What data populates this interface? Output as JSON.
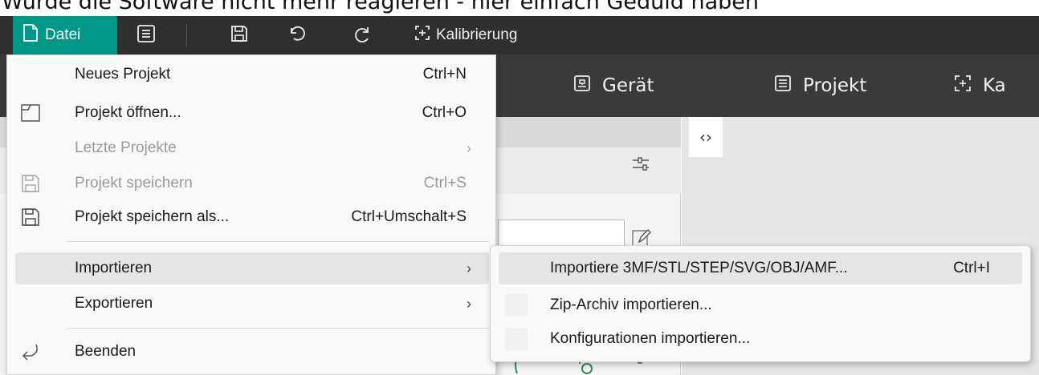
{
  "caption": "Wurde die Software nicht mehr reagieren - hier einfach Geduld haben",
  "toolbar": {
    "file_label": "Datei",
    "calibration_label": "Kalibrierung"
  },
  "tabs": [
    {
      "label": "Gerät"
    },
    {
      "label": "Projekt"
    },
    {
      "label": "Ka"
    }
  ],
  "file_menu": {
    "items": [
      {
        "label": "Neues Projekt",
        "shortcut": "Ctrl+N"
      },
      {
        "label": "Projekt öffnen...",
        "shortcut": "Ctrl+O"
      },
      {
        "label": "Letzte Projekte",
        "shortcut": ""
      },
      {
        "label": "Projekt speichern",
        "shortcut": "Ctrl+S"
      },
      {
        "label": "Projekt speichern als...",
        "shortcut": "Ctrl+Umschalt+S"
      },
      {
        "label": "Importieren",
        "shortcut": ""
      },
      {
        "label": "Exportieren",
        "shortcut": ""
      },
      {
        "label": "Beenden",
        "shortcut": ""
      }
    ]
  },
  "import_submenu": {
    "items": [
      {
        "label": "Importiere 3MF/STL/STEP/SVG/OBJ/AMF...",
        "shortcut": "Ctrl+I"
      },
      {
        "label": "Zip-Archiv importieren...",
        "shortcut": ""
      },
      {
        "label": "Konfigurationen importieren...",
        "shortcut": ""
      }
    ]
  },
  "canvas": {
    "collapse_glyph": "‹›"
  },
  "colors": {
    "accent": "#009688",
    "toolbar_bg": "#2f2f2f",
    "tabbar_bg": "#3a3a3a",
    "menu_bg": "#f9f9f9",
    "highlight": "#e5e5e5"
  }
}
